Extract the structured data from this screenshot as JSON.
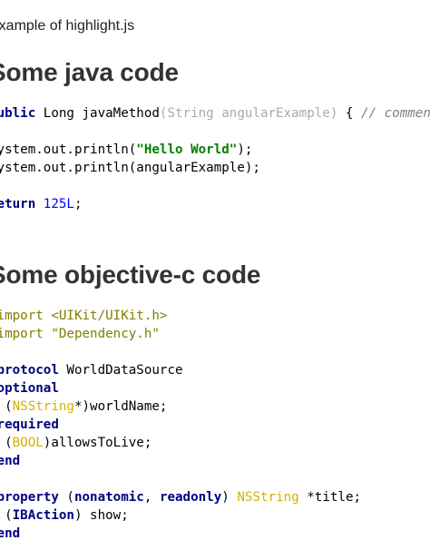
{
  "subtitle": "Example of highlight.js",
  "java": {
    "heading": "Some java code",
    "lines": [
      [
        {
          "t": "public",
          "c": "kw"
        },
        {
          "t": " Long javaMethod",
          "c": "plain"
        },
        {
          "t": "(String angularExample)",
          "c": "par"
        },
        {
          "t": " { ",
          "c": "plain"
        },
        {
          "t": "// comment",
          "c": "cmt"
        }
      ],
      [],
      [
        {
          "t": "System.out.println(",
          "c": "plain"
        },
        {
          "t": "\"Hello World\"",
          "c": "str"
        },
        {
          "t": ");",
          "c": "plain"
        }
      ],
      [
        {
          "t": "System.out.println(angularExample);",
          "c": "plain"
        }
      ],
      [],
      [
        {
          "t": "return",
          "c": "kw"
        },
        {
          "t": " ",
          "c": "plain"
        },
        {
          "t": "125L",
          "c": "num"
        },
        {
          "t": ";",
          "c": "plain"
        }
      ]
    ]
  },
  "objc": {
    "heading": "Some objective-c code",
    "lines": [
      [
        {
          "t": "#import <UIKit/UIKit.h>",
          "c": "meta"
        }
      ],
      [
        {
          "t": "#import \"Dependency.h\"",
          "c": "meta"
        }
      ],
      [],
      [
        {
          "t": "@protocol",
          "c": "kw"
        },
        {
          "t": " WorldDataSource",
          "c": "plain"
        }
      ],
      [
        {
          "t": "@optional",
          "c": "kw"
        }
      ],
      [
        {
          "t": "- (",
          "c": "plain"
        },
        {
          "t": "NSString",
          "c": "typ"
        },
        {
          "t": "*)worldName;",
          "c": "plain"
        }
      ],
      [
        {
          "t": "@required",
          "c": "kw"
        }
      ],
      [
        {
          "t": "- (",
          "c": "plain"
        },
        {
          "t": "BOOL",
          "c": "typ"
        },
        {
          "t": ")allowsToLive;",
          "c": "plain"
        }
      ],
      [
        {
          "t": "@end",
          "c": "kw"
        }
      ],
      [],
      [
        {
          "t": "@property",
          "c": "kw"
        },
        {
          "t": " (",
          "c": "plain"
        },
        {
          "t": "nonatomic",
          "c": "kw"
        },
        {
          "t": ", ",
          "c": "plain"
        },
        {
          "t": "readonly",
          "c": "kw"
        },
        {
          "t": ") ",
          "c": "plain"
        },
        {
          "t": "NSString",
          "c": "typ"
        },
        {
          "t": " *title;",
          "c": "plain"
        }
      ],
      [
        {
          "t": "- (",
          "c": "plain"
        },
        {
          "t": "IBAction",
          "c": "kw"
        },
        {
          "t": ") show;",
          "c": "plain"
        }
      ],
      [
        {
          "t": "@end",
          "c": "kw"
        }
      ]
    ]
  }
}
